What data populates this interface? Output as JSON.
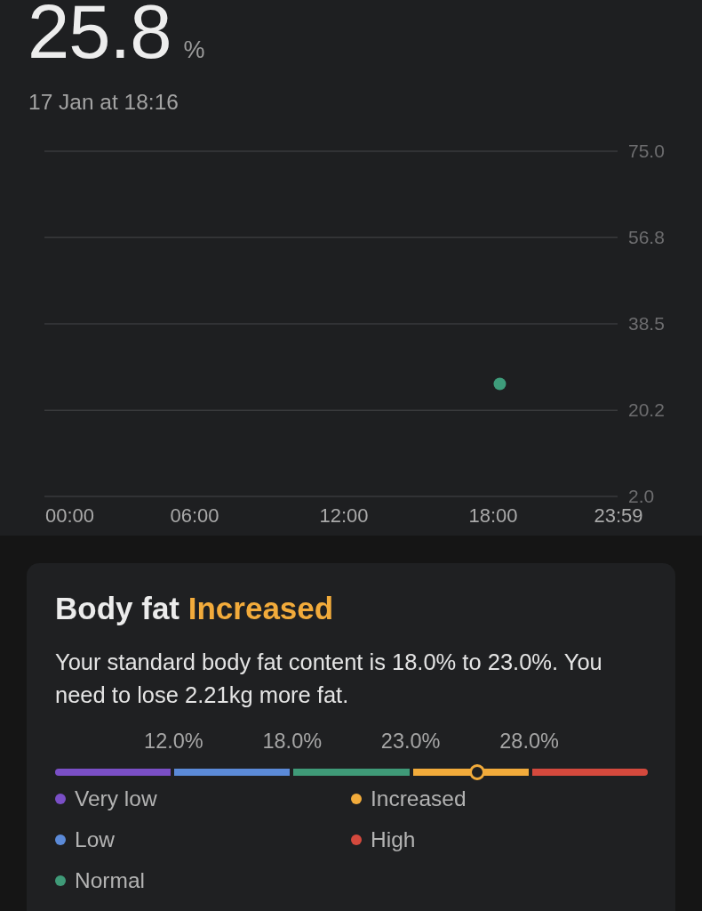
{
  "reading": {
    "value": "25.8",
    "unit": "%",
    "timestamp": "17 Jan at 18:16"
  },
  "chart": {
    "chart_data": {
      "type": "scatter",
      "x": [
        1096
      ],
      "series": [
        {
          "color": "#3e9c7b",
          "values": [
            25.8
          ]
        }
      ],
      "xlim": [
        0,
        1439
      ],
      "ylim": [
        2,
        75
      ],
      "xticks": [
        {
          "value": 0,
          "label": "00:00"
        },
        {
          "value": 360,
          "label": "06:00"
        },
        {
          "value": 720,
          "label": "12:00"
        },
        {
          "value": 1080,
          "label": "18:00"
        },
        {
          "value": 1439,
          "label": "23:59"
        }
      ],
      "yticks": [
        {
          "value": 75,
          "label": "75.0"
        },
        {
          "value": 56.8,
          "label": "56.8"
        },
        {
          "value": 38.5,
          "label": "38.5"
        },
        {
          "value": 20.2,
          "label": "20.2"
        },
        {
          "value": 2,
          "label": "2.0"
        }
      ],
      "grid": true
    }
  },
  "card": {
    "title": "Body fat",
    "status": "Increased",
    "description": "Your standard body fat content is 18.0% to 23.0%. You need to lose 2.21kg more fat.",
    "scale": {
      "ticks": [
        "12.0%",
        "18.0%",
        "23.0%",
        "28.0%"
      ],
      "level": 0.712,
      "segments": [
        {
          "label": "Very low",
          "color": "#7a4fc6"
        },
        {
          "label": "Low",
          "color": "#5b8ad8"
        },
        {
          "label": "Normal",
          "color": "#3f9a78"
        },
        {
          "label": "Increased",
          "color": "#f2ab3b"
        },
        {
          "label": "High",
          "color": "#d4493d"
        }
      ]
    }
  }
}
